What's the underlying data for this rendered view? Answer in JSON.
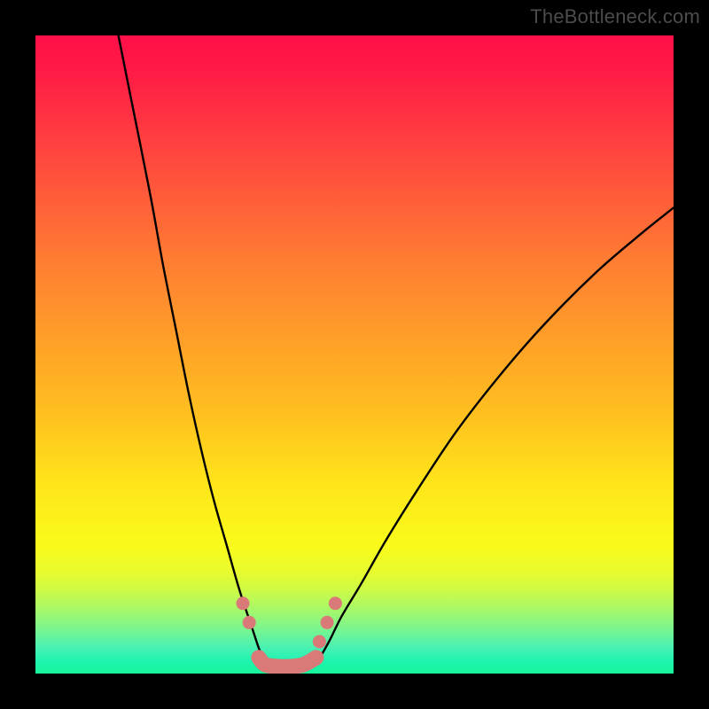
{
  "watermark": "TheBottleneck.com",
  "chart_data": {
    "type": "line",
    "title": "",
    "xlabel": "",
    "ylabel": "",
    "xlim": [
      0,
      100
    ],
    "ylim": [
      0,
      100
    ],
    "series": [
      {
        "name": "left-curve",
        "x": [
          13,
          15,
          18,
          20,
          22,
          24,
          26,
          28,
          30,
          32,
          34,
          35,
          36
        ],
        "values": [
          100,
          90,
          75,
          64,
          54,
          44,
          35,
          27,
          20,
          13,
          7,
          4,
          1.5
        ]
      },
      {
        "name": "right-curve",
        "x": [
          44,
          46,
          48,
          51,
          55,
          60,
          66,
          73,
          80,
          88,
          95,
          100
        ],
        "values": [
          1.5,
          5,
          9,
          14,
          21,
          29,
          38,
          47,
          55,
          63,
          69,
          73
        ]
      },
      {
        "name": "bottom-segment",
        "x": [
          35,
          36,
          38,
          40,
          42,
          44
        ],
        "values": [
          2.5,
          1.4,
          1.1,
          1.1,
          1.4,
          2.5
        ]
      }
    ],
    "markers": {
      "name": "highlight-dots",
      "color": "#d97a78",
      "points": [
        {
          "x": 32.5,
          "y": 11
        },
        {
          "x": 33.5,
          "y": 8
        },
        {
          "x": 44.5,
          "y": 5
        },
        {
          "x": 45.7,
          "y": 8
        },
        {
          "x": 47.0,
          "y": 11
        }
      ]
    },
    "thick_segment": {
      "name": "bottom-u-stroke",
      "color": "#d97a78",
      "width_pct": 2.4
    }
  }
}
